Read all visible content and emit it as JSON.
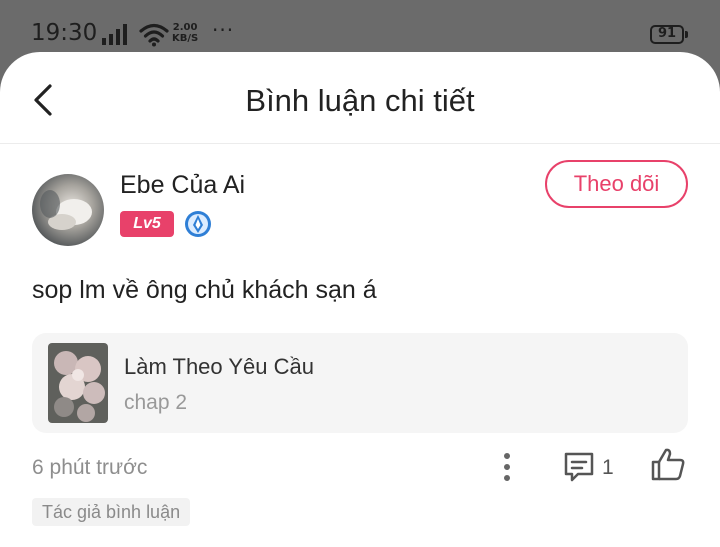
{
  "status_bar": {
    "time": "19:30",
    "speed_value": "2.00",
    "speed_unit": "KB/S",
    "dots": "···",
    "battery": "91"
  },
  "header": {
    "title": "Bình luận chi tiết",
    "back_icon": "chevron-left-icon"
  },
  "user": {
    "name": "Ebe Của Ai",
    "level": "Lv5",
    "follow_label": "Theo dõi",
    "medal_icon": "medal-icon"
  },
  "comment": {
    "text": "sop lm về ông chủ khách sạn á"
  },
  "work_card": {
    "title": "Làm Theo Yêu Cầu",
    "chapter": "chap 2"
  },
  "footer": {
    "time_ago": "6 phút trước",
    "reply_count": "1",
    "author_tag": "Tác giả bình luận",
    "icons": [
      "more-vertical-icon",
      "comment-icon",
      "thumbs-up-icon"
    ]
  },
  "colors": {
    "accent": "#e8416a",
    "card_bg": "#f5f5f5",
    "overlay": "#6b6b6b"
  }
}
